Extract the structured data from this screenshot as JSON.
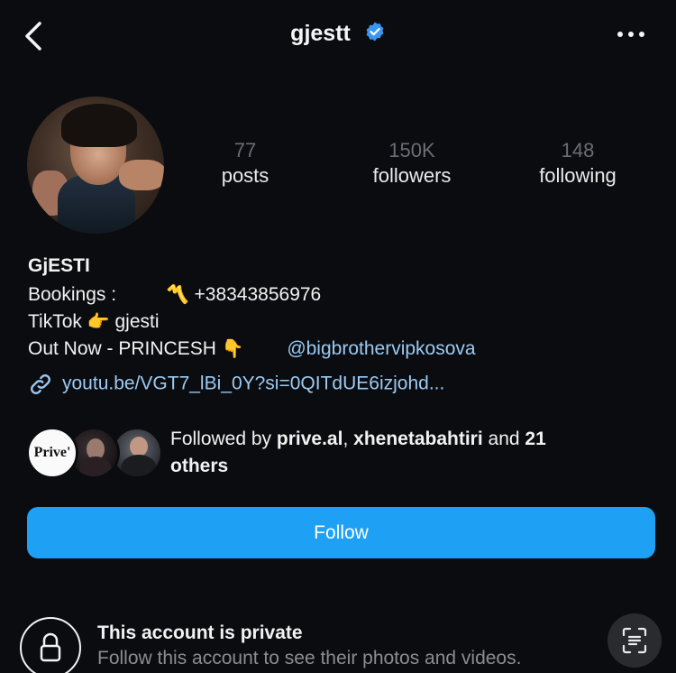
{
  "header": {
    "username": "gjestt",
    "verified_icon": "verified-badge-icon",
    "back_icon": "chevron-left-icon",
    "more_icon": "more-horizontal-icon"
  },
  "stats": [
    {
      "value": "77",
      "label": "posts"
    },
    {
      "value": "150K",
      "label": "followers"
    },
    {
      "value": "148",
      "label": "following"
    }
  ],
  "bio": {
    "name": "GjESTI",
    "bookings_label": "Bookings :",
    "bookings_emoji": "〽️",
    "phone": "+38343856976",
    "tiktok_label": "TikTok",
    "tiktok_emoji": "👉",
    "tiktok_handle": "gjesti",
    "out_now": "Out Now - PRINCESH",
    "out_now_emoji": "👇",
    "mention": "@bigbrothervipkosova",
    "link": "youtu.be/VGT7_lBi_0Y?si=0QITdUE6izjohd..."
  },
  "followed_by": {
    "prefix": "Followed by",
    "user1": "prive.al",
    "sep": ",",
    "user2": "xhenetabahtiri",
    "and_text": "and",
    "count": "21",
    "others": "others",
    "avatar1_text": "Prive'"
  },
  "follow_button": {
    "label": "Follow"
  },
  "private_notice": {
    "title": "This account is private",
    "subtitle": "Follow this account to see their photos and videos.",
    "lock_icon": "lock-icon",
    "scan_icon": "scan-text-icon"
  },
  "colors": {
    "background": "#0b0c10",
    "accent": "#1ea0f4",
    "link": "#9ccaf2",
    "muted": "#8a8c90"
  }
}
